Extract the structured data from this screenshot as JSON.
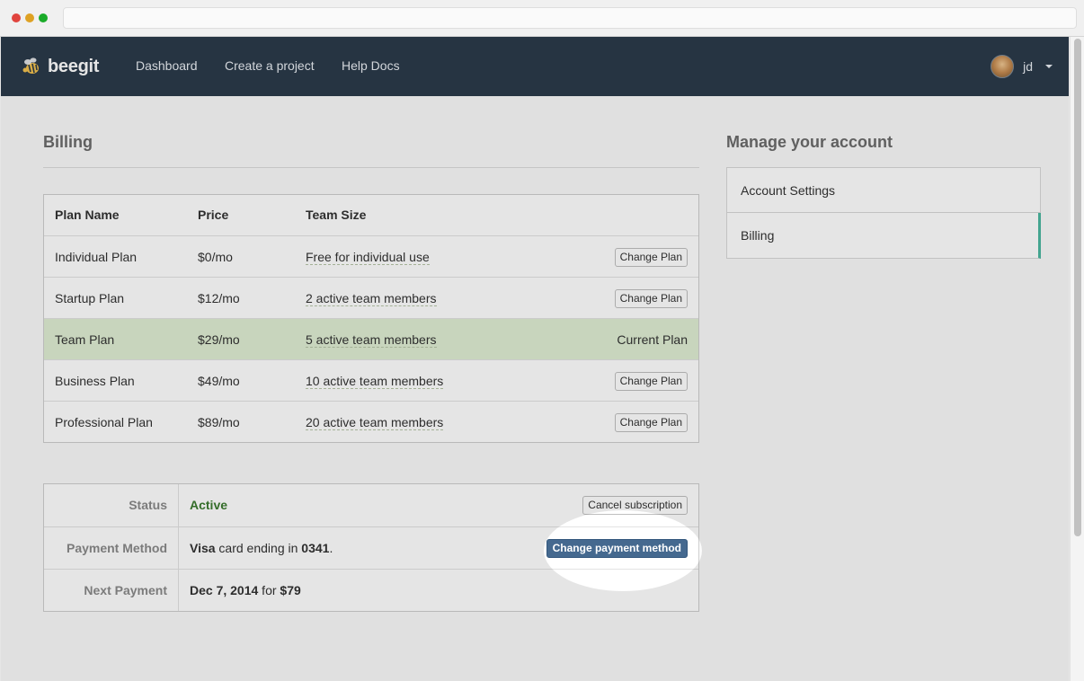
{
  "nav": {
    "brand": "beegit",
    "links": [
      "Dashboard",
      "Create a project",
      "Help Docs"
    ],
    "user": "jd"
  },
  "billing": {
    "title": "Billing",
    "headers": {
      "name": "Plan Name",
      "price": "Price",
      "team": "Team Size"
    },
    "plans": [
      {
        "name": "Individual Plan",
        "price": "$0/mo",
        "team": "Free for individual use",
        "action": "Change Plan"
      },
      {
        "name": "Startup Plan",
        "price": "$12/mo",
        "team": "2 active team members",
        "action": "Change Plan"
      },
      {
        "name": "Team Plan",
        "price": "$29/mo",
        "team": "5 active team members",
        "action": "Current Plan"
      },
      {
        "name": "Business Plan",
        "price": "$49/mo",
        "team": "10 active team members",
        "action": "Change Plan"
      },
      {
        "name": "Professional Plan",
        "price": "$89/mo",
        "team": "20 active team members",
        "action": "Change Plan"
      }
    ]
  },
  "details": {
    "status_label": "Status",
    "status_value": "Active",
    "cancel_button": "Cancel subscription",
    "payment_label": "Payment Method",
    "card_brand": "Visa",
    "card_text": " card ending in ",
    "card_last4": "0341",
    "card_period": ".",
    "change_payment_button": "Change payment method",
    "next_label": "Next Payment",
    "next_date": "Dec 7, 2014",
    "next_for": " for ",
    "next_amount": "$79"
  },
  "account": {
    "title": "Manage your account",
    "items": [
      "Account Settings",
      "Billing"
    ]
  },
  "colors": {
    "navbar": "#2b3a4a",
    "current_plan_row": "#dfeed3",
    "primary_button": "#45698f",
    "active_accent": "#4bb7a0",
    "status_active": "#3a7a2e"
  }
}
